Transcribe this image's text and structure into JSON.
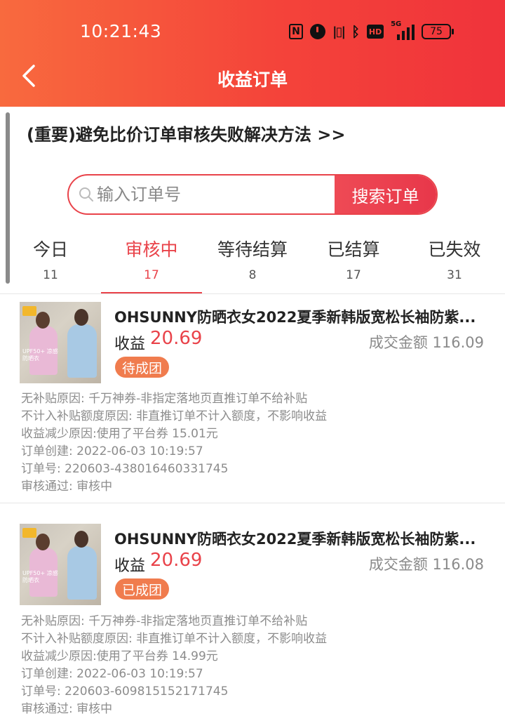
{
  "status_bar": {
    "time": "10:21:43",
    "icons": [
      "nfc-icon",
      "alarm-icon",
      "vibrate-icon",
      "bluetooth-icon",
      "hd-icon",
      "5g-signal-icon",
      "battery-icon"
    ],
    "battery": "75",
    "network": "5G"
  },
  "header": {
    "title": "收益订单",
    "background_color": "#f4433a"
  },
  "notice": "(重要)避免比价订单审核失败解决方法 >>",
  "search": {
    "placeholder": "输入订单号",
    "value": "",
    "button_label": "搜索订单"
  },
  "tabs": [
    {
      "label": "今日",
      "count": "11"
    },
    {
      "label": "审核中",
      "count": "17"
    },
    {
      "label": "等待结算",
      "count": "8"
    },
    {
      "label": "已结算",
      "count": "17"
    },
    {
      "label": "已失效",
      "count": "31"
    }
  ],
  "active_tab": "审核中",
  "accent_color": "#e9434a",
  "orders": [
    {
      "image_text": "UPF50+ 凉感防晒衣",
      "title": "OHSUNNY防晒衣女2022夏季新韩版宽松长袖防紫...",
      "income_label": "收益",
      "income": "20.69",
      "amount_label": "成交金额",
      "amount": "116.09",
      "status": "待成团",
      "details": [
        "无补贴原因: 千万神券-非指定落地页直推订单不给补贴",
        "不计入补贴额度原因: 非直推订单不计入额度，不影响收益",
        "收益减少原因:使用了平台券 15.01元",
        "订单创建: 2022-06-03 10:19:57",
        "订单号: 220603-438016460331745",
        "审核通过: 审核中"
      ]
    },
    {
      "image_text": "UPF50+ 凉感防晒衣",
      "title": "OHSUNNY防晒衣女2022夏季新韩版宽松长袖防紫...",
      "income_label": "收益",
      "income": "20.69",
      "amount_label": "成交金额",
      "amount": "116.08",
      "status": "已成团",
      "details": [
        "无补贴原因: 千万神券-非指定落地页直推订单不给补贴",
        "不计入补贴额度原因: 非直推订单不计入额度，不影响收益",
        "收益减少原因:使用了平台券 14.99元",
        "订单创建: 2022-06-03 10:19:57",
        "订单号: 220603-609815152171745",
        "审核通过: 审核中"
      ]
    }
  ]
}
